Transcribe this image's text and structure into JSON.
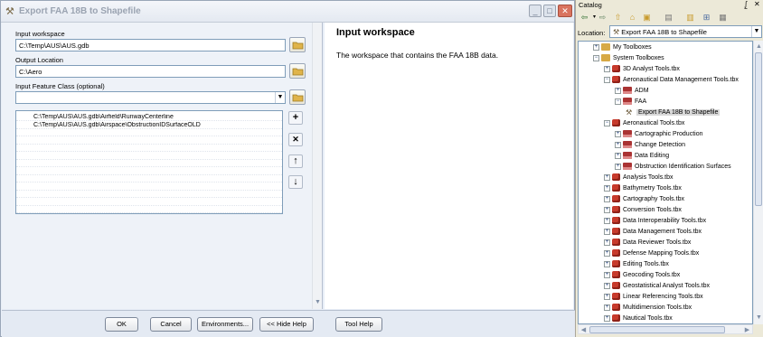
{
  "dialog": {
    "title": "Export FAA 18B to Shapefile",
    "input_workspace_label": "Input workspace",
    "input_workspace_value": "C:\\Temp\\AUS\\AUS.gdb",
    "output_location_label": "Output Location",
    "output_location_value": "C:\\Aero",
    "input_feature_class_label": "Input Feature Class (optional)",
    "input_feature_class_value": "",
    "feature_list": [
      "C:\\Temp\\AUS\\AUS.gdb\\Airfield\\RunwayCenterline",
      "C:\\Temp\\AUS\\AUS.gdb\\Airspace\\ObstructionIDSurfaceOLD"
    ],
    "buttons": {
      "ok": "OK",
      "cancel": "Cancel",
      "environments": "Environments...",
      "hide_help": "<< Hide Help",
      "tool_help": "Tool Help"
    }
  },
  "help": {
    "title": "Input workspace",
    "body": "The workspace that contains the FAA 18B data."
  },
  "catalog": {
    "title": "Catalog",
    "pin": "⨜",
    "close": "✕",
    "location_label": "Location:",
    "location_value": "Export FAA 18B to Shapefile",
    "tree": [
      {
        "label": "My Toolboxes",
        "indent": 0,
        "icon": "folder",
        "exp": "+"
      },
      {
        "label": "System Toolboxes",
        "indent": 0,
        "icon": "folder",
        "exp": "-"
      },
      {
        "label": "3D Analyst Tools.tbx",
        "indent": 1,
        "icon": "toolbox",
        "exp": "+"
      },
      {
        "label": "Aeronautical Data Management Tools.tbx",
        "indent": 1,
        "icon": "toolbox",
        "exp": "-"
      },
      {
        "label": "ADM",
        "indent": 2,
        "icon": "toolset",
        "exp": "+"
      },
      {
        "label": "FAA",
        "indent": 2,
        "icon": "toolset",
        "exp": "-"
      },
      {
        "label": "Export FAA 18B to Shapefile",
        "indent": 3,
        "icon": "tool",
        "exp": "",
        "selected": true
      },
      {
        "label": "Aeronautical Tools.tbx",
        "indent": 1,
        "icon": "toolbox",
        "exp": "-"
      },
      {
        "label": "Cartographic Production",
        "indent": 2,
        "icon": "toolset",
        "exp": "+"
      },
      {
        "label": "Change Detection",
        "indent": 2,
        "icon": "toolset",
        "exp": "+"
      },
      {
        "label": "Data Editing",
        "indent": 2,
        "icon": "toolset",
        "exp": "+"
      },
      {
        "label": "Obstruction Identification Surfaces",
        "indent": 2,
        "icon": "toolset",
        "exp": "+"
      },
      {
        "label": "Analysis Tools.tbx",
        "indent": 1,
        "icon": "toolbox",
        "exp": "+"
      },
      {
        "label": "Bathymetry Tools.tbx",
        "indent": 1,
        "icon": "toolbox",
        "exp": "+"
      },
      {
        "label": "Cartography Tools.tbx",
        "indent": 1,
        "icon": "toolbox",
        "exp": "+"
      },
      {
        "label": "Conversion Tools.tbx",
        "indent": 1,
        "icon": "toolbox",
        "exp": "+"
      },
      {
        "label": "Data Interoperability Tools.tbx",
        "indent": 1,
        "icon": "toolbox",
        "exp": "+"
      },
      {
        "label": "Data Management Tools.tbx",
        "indent": 1,
        "icon": "toolbox",
        "exp": "+"
      },
      {
        "label": "Data Reviewer Tools.tbx",
        "indent": 1,
        "icon": "toolbox",
        "exp": "+"
      },
      {
        "label": "Defense Mapping Tools.tbx",
        "indent": 1,
        "icon": "toolbox",
        "exp": "+"
      },
      {
        "label": "Editing Tools.tbx",
        "indent": 1,
        "icon": "toolbox",
        "exp": "+"
      },
      {
        "label": "Geocoding Tools.tbx",
        "indent": 1,
        "icon": "toolbox",
        "exp": "+"
      },
      {
        "label": "Geostatistical Analyst Tools.tbx",
        "indent": 1,
        "icon": "toolbox",
        "exp": "+"
      },
      {
        "label": "Linear Referencing Tools.tbx",
        "indent": 1,
        "icon": "toolbox",
        "exp": "+"
      },
      {
        "label": "Multidimension Tools.tbx",
        "indent": 1,
        "icon": "toolbox",
        "exp": "+"
      },
      {
        "label": "Nautical Tools.tbx",
        "indent": 1,
        "icon": "toolbox",
        "exp": "+"
      }
    ]
  },
  "colors": {
    "dialog_bg": "#e8eef7",
    "catalog_bg": "#ece9d8",
    "close_red": "#d9735f"
  }
}
